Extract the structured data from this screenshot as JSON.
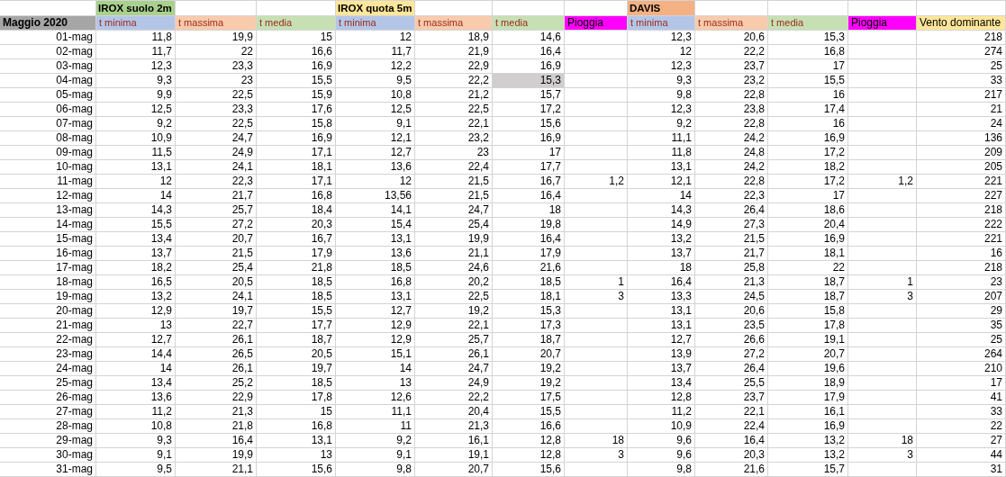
{
  "table": {
    "group_row": {
      "cells": [
        null,
        {
          "label": "IROX suolo 2m",
          "color": "#a9d08e"
        },
        null,
        null,
        {
          "label": "IROX quota 5m",
          "color": "#ffe699"
        },
        null,
        null,
        null,
        {
          "label": "DAVIS",
          "color": "#f4b183"
        },
        null,
        null,
        null,
        null
      ]
    },
    "columns": [
      {
        "label": "Maggio 2020",
        "kind": "title",
        "color": "#a6a6a6"
      },
      {
        "label": "t minima",
        "kind": "measure",
        "color": "#b4c6e7"
      },
      {
        "label": "t massima",
        "kind": "measure",
        "color": "#f8cbad"
      },
      {
        "label": "t media",
        "kind": "measure",
        "color": "#c6e0b4"
      },
      {
        "label": "t minima",
        "kind": "measure",
        "color": "#b4c6e7"
      },
      {
        "label": "t massima",
        "kind": "measure",
        "color": "#f8cbad"
      },
      {
        "label": "t media",
        "kind": "measure",
        "color": "#c6e0b4"
      },
      {
        "label": "Pioggia",
        "kind": "plain",
        "color": "#ff00ff"
      },
      {
        "label": "t minima",
        "kind": "measure",
        "color": "#b4c6e7"
      },
      {
        "label": "t massima",
        "kind": "measure",
        "color": "#f8cbad"
      },
      {
        "label": "t media",
        "kind": "measure",
        "color": "#c6e0b4"
      },
      {
        "label": "Pioggia",
        "kind": "plain",
        "color": "#ff00ff"
      },
      {
        "label": "Vento dominante",
        "kind": "plain",
        "color": "#ffe699"
      }
    ],
    "rows": [
      {
        "cells": [
          "01-mag",
          "11,8",
          "19,9",
          "15",
          "12",
          "18,9",
          "14,6",
          null,
          "12,3",
          "20,6",
          "15,3",
          null,
          "218"
        ]
      },
      {
        "cells": [
          "02-mag",
          "11,7",
          "22",
          "16,6",
          "11,7",
          "21,9",
          "16,4",
          null,
          "12",
          "22,2",
          "16,8",
          null,
          "274"
        ]
      },
      {
        "cells": [
          "03-mag",
          "12,3",
          "23,3",
          "16,9",
          "12,2",
          "22,9",
          "16,9",
          null,
          "12,3",
          "23,7",
          "17",
          null,
          "25"
        ]
      },
      {
        "cells": [
          "04-mag",
          "9,3",
          "23",
          "15,5",
          "9,5",
          "22,2",
          {
            "value": "15,3",
            "selected": true
          },
          null,
          "9,3",
          "23,2",
          "15,5",
          null,
          "33"
        ]
      },
      {
        "cells": [
          "05-mag",
          "9,9",
          "22,5",
          "15,9",
          "10,8",
          "21,2",
          "15,7",
          null,
          "9,8",
          "22,8",
          "16",
          null,
          "217"
        ]
      },
      {
        "cells": [
          "06-mag",
          "12,5",
          "23,3",
          "17,6",
          "12,5",
          "22,5",
          "17,2",
          null,
          "12,3",
          "23,8",
          "17,4",
          null,
          "21"
        ]
      },
      {
        "cells": [
          "07-mag",
          "9,2",
          "22,5",
          "15,8",
          "9,1",
          "22,1",
          "15,6",
          null,
          "9,2",
          "22,8",
          "16",
          null,
          "24"
        ]
      },
      {
        "cells": [
          "08-mag",
          "10,9",
          "24,7",
          "16,9",
          "12,1",
          "23,2",
          "16,9",
          null,
          "11,1",
          "24,2",
          "16,9",
          null,
          "136"
        ]
      },
      {
        "cells": [
          "09-mag",
          "11,5",
          "24,9",
          "17,1",
          "12,7",
          "23",
          "17",
          null,
          "11,8",
          "24,8",
          "17,2",
          null,
          "209"
        ]
      },
      {
        "cells": [
          "10-mag",
          "13,1",
          "24,1",
          "18,1",
          "13,6",
          "22,4",
          "17,7",
          null,
          "13,1",
          "24,2",
          "18,2",
          null,
          "205"
        ]
      },
      {
        "cells": [
          "11-mag",
          "12",
          "22,3",
          "17,1",
          "12",
          "21,5",
          "16,7",
          "1,2",
          "12,1",
          "22,8",
          "17,2",
          "1,2",
          "221"
        ]
      },
      {
        "cells": [
          "12-mag",
          "14",
          "21,7",
          "16,8",
          "13,56",
          "21,5",
          "16,4",
          null,
          "14",
          "22,3",
          "17",
          null,
          "227"
        ]
      },
      {
        "cells": [
          "13-mag",
          "14,3",
          "25,7",
          "18,4",
          "14,1",
          "24,7",
          "18",
          null,
          "14,3",
          "26,4",
          "18,6",
          null,
          "218"
        ]
      },
      {
        "cells": [
          "14-mag",
          "15,5",
          "27,2",
          "20,3",
          "15,4",
          "25,4",
          "19,8",
          null,
          "14,9",
          "27,3",
          "20,4",
          null,
          "222"
        ]
      },
      {
        "cells": [
          "15-mag",
          "13,4",
          "20,7",
          "16,7",
          "13,1",
          "19,9",
          "16,4",
          null,
          "13,2",
          "21,5",
          "16,9",
          null,
          "221"
        ]
      },
      {
        "cells": [
          "16-mag",
          "13,7",
          "21,5",
          "17,9",
          "13,6",
          "21,1",
          "17,9",
          null,
          "13,7",
          "21,7",
          "18,1",
          null,
          "16"
        ]
      },
      {
        "cells": [
          "17-mag",
          "18,2",
          "25,4",
          "21,8",
          "18,5",
          "24,6",
          "21,6",
          null,
          "18",
          "25,8",
          "22",
          null,
          "218"
        ]
      },
      {
        "cells": [
          "18-mag",
          "16,5",
          "20,5",
          "18,5",
          "16,8",
          "20,2",
          "18,5",
          "1",
          "16,4",
          "21,3",
          "18,7",
          "1",
          "23"
        ]
      },
      {
        "cells": [
          "19-mag",
          "13,2",
          "24,1",
          "18,5",
          "13,1",
          "22,5",
          "18,1",
          "3",
          "13,3",
          "24,5",
          "18,7",
          "3",
          "207"
        ]
      },
      {
        "cells": [
          "20-mag",
          "12,9",
          "19,7",
          "15,5",
          "12,7",
          "19,2",
          "15,3",
          null,
          "13,1",
          "20,6",
          "15,8",
          null,
          "29"
        ]
      },
      {
        "cells": [
          "21-mag",
          "13",
          "22,7",
          "17,7",
          "12,9",
          "22,1",
          "17,3",
          null,
          "13,1",
          "23,5",
          "17,8",
          null,
          "35"
        ]
      },
      {
        "cells": [
          "22-mag",
          "12,7",
          "26,1",
          "18,7",
          "12,9",
          "25,7",
          "18,7",
          null,
          "12,7",
          "26,6",
          "19,1",
          null,
          "25"
        ]
      },
      {
        "cells": [
          "23-mag",
          "14,4",
          "26,5",
          "20,5",
          "15,1",
          "26,1",
          "20,7",
          null,
          "13,9",
          "27,2",
          "20,7",
          null,
          "264"
        ]
      },
      {
        "cells": [
          "24-mag",
          "14",
          "26,1",
          "19,7",
          "14",
          "24,7",
          "19,2",
          null,
          "13,7",
          "26,4",
          "19,6",
          null,
          "210"
        ]
      },
      {
        "cells": [
          "25-mag",
          "13,4",
          "25,2",
          "18,5",
          "13",
          "24,9",
          "19,2",
          null,
          "13,4",
          "25,5",
          "18,9",
          null,
          "17"
        ]
      },
      {
        "cells": [
          "26-mag",
          "13,6",
          "22,9",
          "17,8",
          "12,6",
          "22,2",
          "17,5",
          null,
          "12,8",
          "23,7",
          "17,9",
          null,
          "41"
        ]
      },
      {
        "cells": [
          "27-mag",
          "11,2",
          "21,3",
          "15",
          "11,1",
          "20,4",
          "15,5",
          null,
          "11,2",
          "22,1",
          "16,1",
          null,
          "33"
        ]
      },
      {
        "cells": [
          "28-mag",
          "10,8",
          "21,8",
          "16,8",
          "11",
          "21,3",
          "16,6",
          null,
          "10,9",
          "22,4",
          "16,9",
          null,
          "22"
        ]
      },
      {
        "cells": [
          "29-mag",
          "9,3",
          "16,4",
          "13,1",
          "9,2",
          "16,1",
          "12,8",
          "18",
          "9,6",
          "16,4",
          "13,2",
          "18",
          "27"
        ]
      },
      {
        "cells": [
          "30-mag",
          "9,1",
          "19,9",
          "13",
          "9,1",
          "19,1",
          "12,8",
          "3",
          "9,6",
          "20,3",
          "13,2",
          "3",
          "44"
        ]
      },
      {
        "cells": [
          "31-mag",
          "9,5",
          "21,1",
          "15,6",
          "9,8",
          "20,7",
          "15,6",
          null,
          "9,8",
          "21,6",
          "15,7",
          null,
          "31"
        ]
      }
    ]
  }
}
